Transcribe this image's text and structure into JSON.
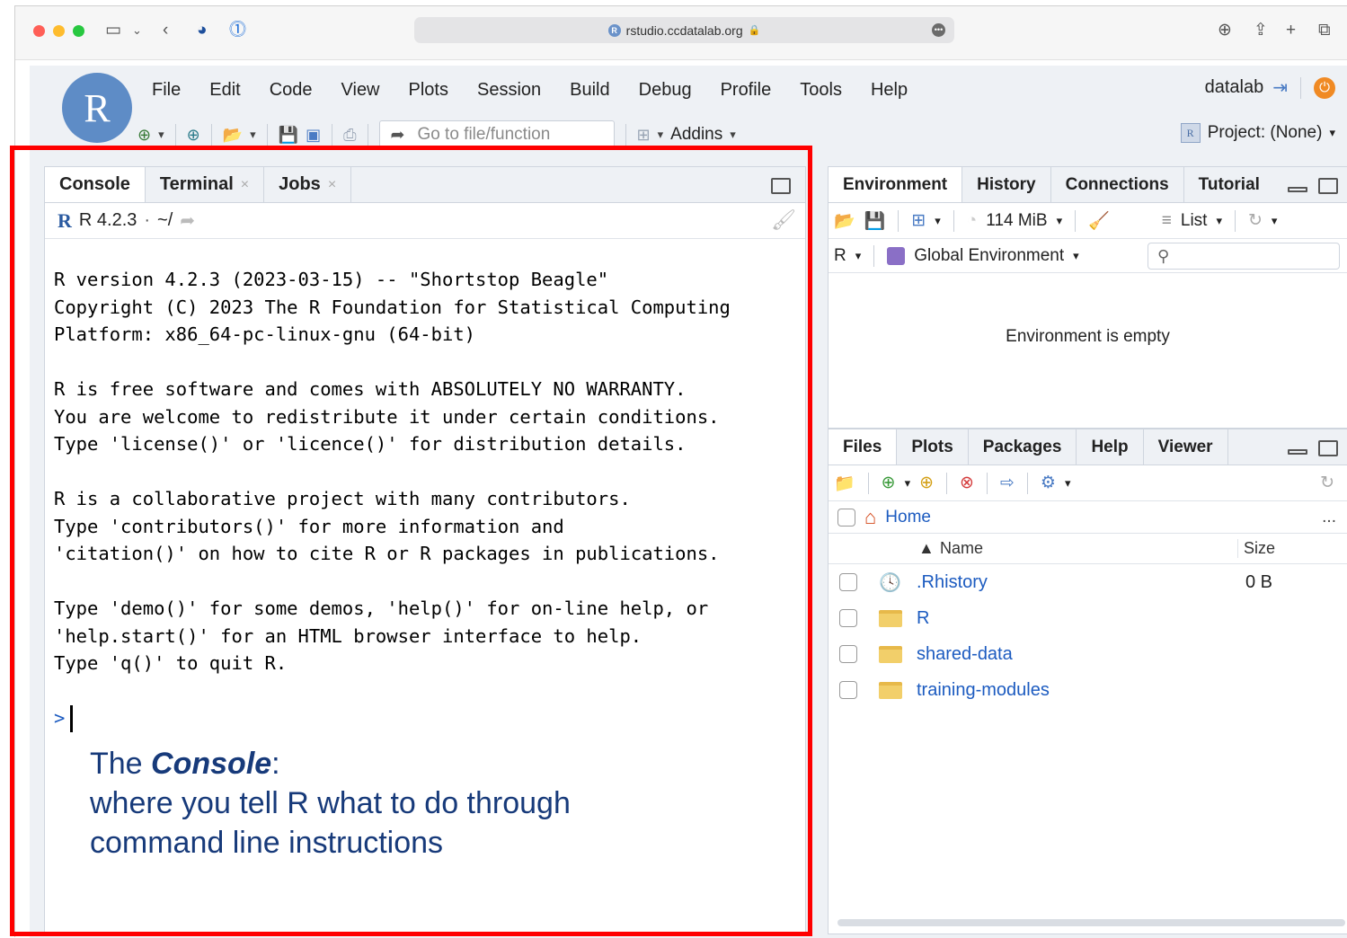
{
  "browser": {
    "url": "rstudio.ccdatalab.org",
    "traffic_colors": [
      "#ff5f57",
      "#febc2e",
      "#28c840"
    ]
  },
  "menu": {
    "items": [
      "File",
      "Edit",
      "Code",
      "View",
      "Plots",
      "Session",
      "Build",
      "Debug",
      "Profile",
      "Tools",
      "Help"
    ],
    "user": "datalab"
  },
  "toolbar": {
    "goto_placeholder": "Go to file/function",
    "addins": "Addins",
    "project": "Project: (None)"
  },
  "console": {
    "tabs": [
      "Console",
      "Terminal",
      "Jobs"
    ],
    "version": "R 4.2.3",
    "dir": "~/",
    "lines": [
      "R version 4.2.3 (2023-03-15) -- \"Shortstop Beagle\"",
      "Copyright (C) 2023 The R Foundation for Statistical Computing",
      "Platform: x86_64-pc-linux-gnu (64-bit)",
      "",
      "R is free software and comes with ABSOLUTELY NO WARRANTY.",
      "You are welcome to redistribute it under certain conditions.",
      "Type 'license()' or 'licence()' for distribution details.",
      "",
      "R is a collaborative project with many contributors.",
      "Type 'contributors()' for more information and",
      "'citation()' on how to cite R or R packages in publications.",
      "",
      "Type 'demo()' for some demos, 'help()' for on-line help, or",
      "'help.start()' for an HTML browser interface to help.",
      "Type 'q()' to quit R."
    ],
    "prompt": ">"
  },
  "caption": {
    "prefix": "The ",
    "emphasis": "Console",
    "colon": ":",
    "line2": "where you tell R what to do through",
    "line3": "command line instructions"
  },
  "env": {
    "tabs": [
      "Environment",
      "History",
      "Connections",
      "Tutorial"
    ],
    "memory": "114 MiB",
    "view": "List",
    "lang": "R",
    "scope": "Global Environment",
    "empty_msg": "Environment is empty"
  },
  "files": {
    "tabs": [
      "Files",
      "Plots",
      "Packages",
      "Help",
      "Viewer"
    ],
    "path": "Home",
    "more": "...",
    "col_name": "Name",
    "col_size": "Size",
    "rows": [
      {
        "name": ".Rhistory",
        "size": "0 B"
      },
      {
        "name": "R",
        "size": ""
      },
      {
        "name": "shared-data",
        "size": ""
      },
      {
        "name": "training-modules",
        "size": ""
      }
    ]
  },
  "colors": {
    "highlight": "#ff0000",
    "link": "#1c5bc0",
    "caption": "#173a7a"
  }
}
